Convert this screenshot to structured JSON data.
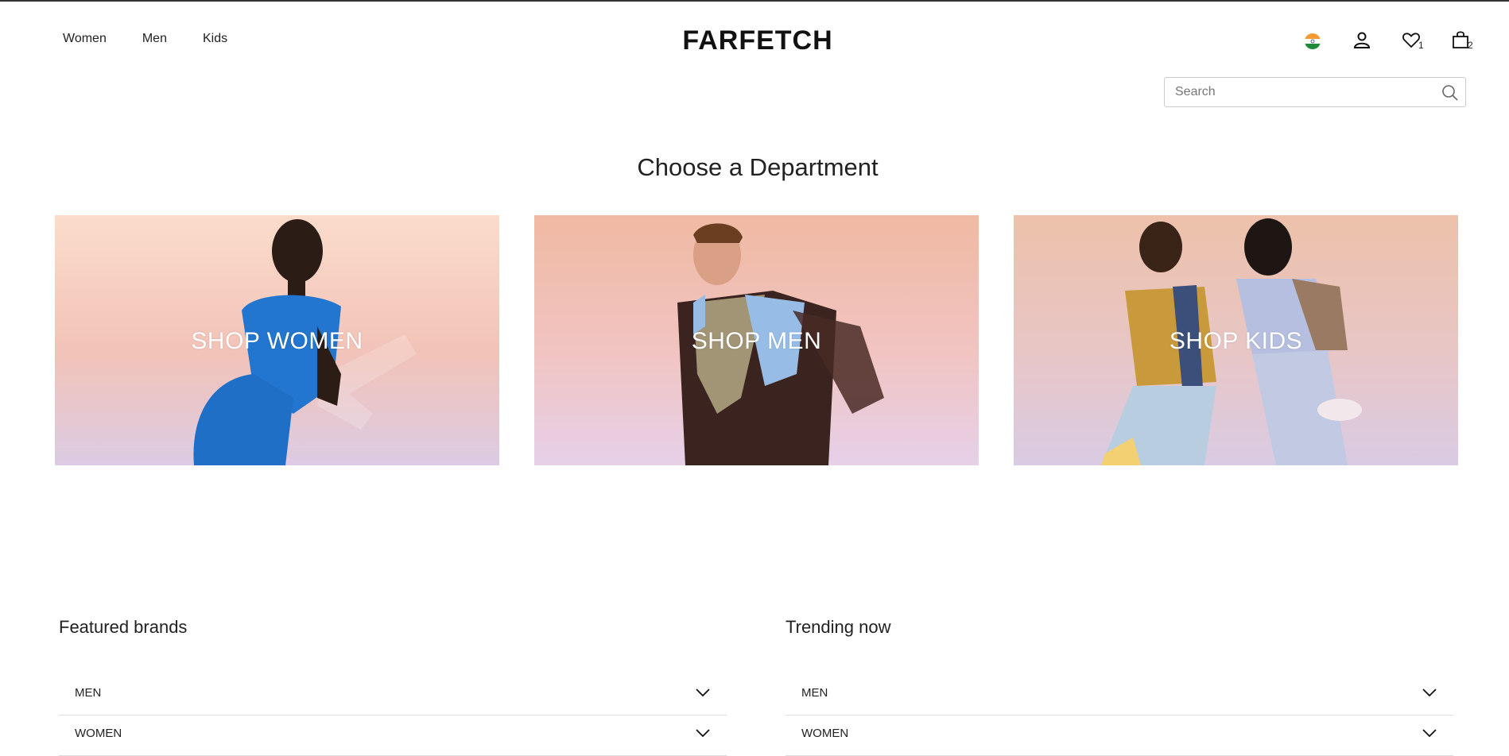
{
  "nav": {
    "items": [
      {
        "label": "Women"
      },
      {
        "label": "Men"
      },
      {
        "label": "Kids"
      }
    ]
  },
  "logo": "FARFETCH",
  "header_icons": {
    "wishlist_count": "1",
    "bag_count": "2"
  },
  "search": {
    "placeholder": "Search"
  },
  "page": {
    "heading": "Choose a Department"
  },
  "departments": [
    {
      "label": "SHOP WOMEN"
    },
    {
      "label": "SHOP MEN"
    },
    {
      "label": "SHOP KIDS"
    }
  ],
  "featured_brands": {
    "title": "Featured brands",
    "items": [
      {
        "label": "MEN"
      },
      {
        "label": "WOMEN"
      }
    ]
  },
  "trending_now": {
    "title": "Trending now",
    "items": [
      {
        "label": "MEN"
      },
      {
        "label": "WOMEN"
      }
    ]
  },
  "colors": {
    "text": "#222222",
    "border": "#dddddd",
    "background": "#ffffff"
  }
}
